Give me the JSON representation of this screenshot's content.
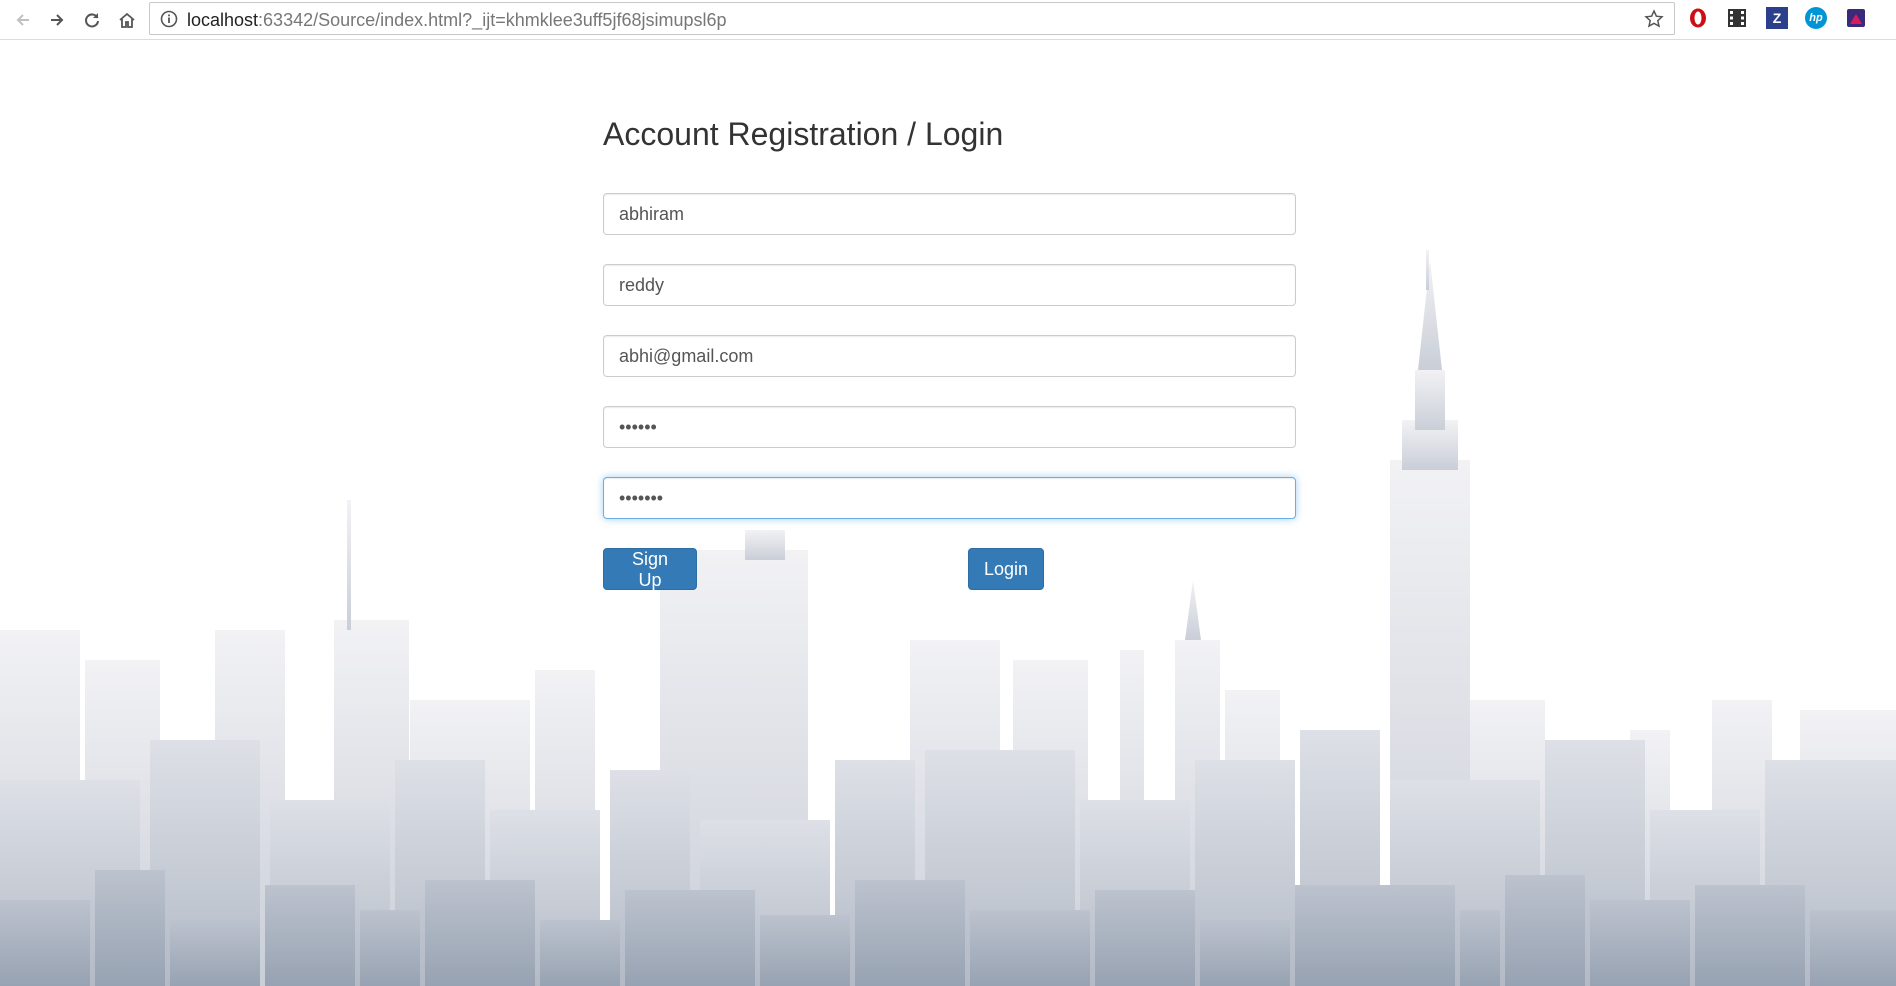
{
  "browser": {
    "url_host": "localhost",
    "url_rest": ":63342/Source/index.html?_ijt=khmklee3uff5jf68jsimupsl6p",
    "nav_icons": [
      "back-icon",
      "forward-icon",
      "reload-icon",
      "home-icon"
    ],
    "extensions": [
      {
        "name": "opera-extension-icon",
        "glyph": "O",
        "color": "#cc0f16"
      },
      {
        "name": "film-extension-icon",
        "glyph": "",
        "color": "#333333"
      },
      {
        "name": "zotero-extension-icon",
        "glyph": "Z",
        "color": "#2b3f8c"
      },
      {
        "name": "hp-extension-icon",
        "glyph": "hp",
        "color": "#0096d6"
      },
      {
        "name": "profile-extension-icon",
        "glyph": "",
        "color": "#3b2a7a"
      }
    ]
  },
  "form": {
    "title": "Account Registration / Login",
    "fields": {
      "first_name": "abhiram",
      "last_name": "reddy",
      "email": "abhi@gmail.com",
      "password": "••••••",
      "confirm_password": "•••••••"
    },
    "signup_label": "Sign Up",
    "login_label": "Login"
  },
  "colors": {
    "primary_button": "#337ab7",
    "focus_border": "#66afe9",
    "skyline_light": "#f0f0f3",
    "skyline_dark": "#9aa5b5"
  }
}
